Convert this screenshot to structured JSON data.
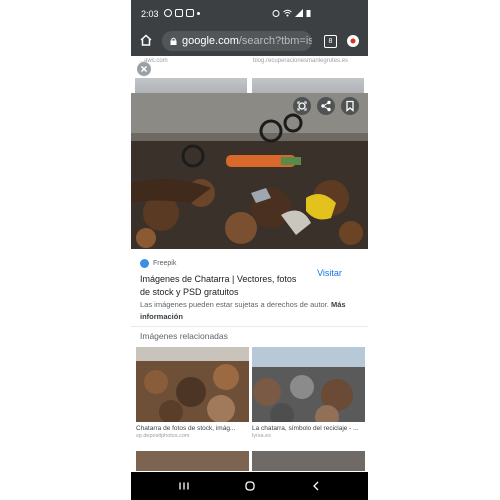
{
  "status_bar": {
    "time": "2:03"
  },
  "browser": {
    "url_host": "google.com",
    "url_path": "/search?tbm=is",
    "tab_count": "8"
  },
  "background_page": {
    "left_label": "...aws.com",
    "right_label": "blog.recuperacionesmanlegrutes.es"
  },
  "result": {
    "source": "Freepik",
    "title": "Imágenes de Chatarra | Vectores, fotos de stock y PSD gratuitos",
    "visit_label": "Visitar",
    "disclaimer_text": "Las imágenes pueden estar sujetas a derechos de autor.",
    "disclaimer_link": "Más información"
  },
  "related": {
    "heading": "Imágenes relacionadas",
    "items": [
      {
        "caption": "Chatarra de fotos de stock, imág...",
        "domain": "sp.depositphotos.com"
      },
      {
        "caption": "La chatarra, símbolo del reciclaje - ...",
        "domain": "lyrsa.es"
      }
    ]
  },
  "colors": {
    "chrome_bar": "#3c4043",
    "link_blue": "#1a73e8"
  }
}
